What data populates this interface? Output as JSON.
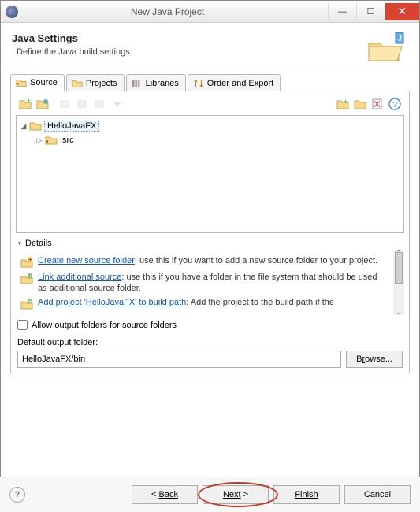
{
  "window": {
    "title": "New Java Project"
  },
  "header": {
    "title": "Java Settings",
    "subtitle": "Define the Java build settings."
  },
  "tabs": [
    {
      "label": "Source",
      "icon": "source-folder-icon",
      "active": true
    },
    {
      "label": "Projects",
      "icon": "projects-icon",
      "active": false
    },
    {
      "label": "Libraries",
      "icon": "libraries-icon",
      "active": false
    },
    {
      "label": "Order and Export",
      "icon": "order-export-icon",
      "active": false
    }
  ],
  "tree": {
    "root": {
      "label": "HelloJavaFX",
      "expanded": true,
      "selected": true
    },
    "children": [
      {
        "label": "src",
        "expanded": false
      }
    ]
  },
  "details": {
    "heading": "Details",
    "items": [
      {
        "link": "Create new source folder",
        "rest": ": use this if you want to add a new source folder to your project.",
        "icon": "new-source-folder-icon"
      },
      {
        "link": "Link additional source",
        "rest": ": use this if you have a folder in the file system that should be used as additional source folder.",
        "icon": "link-source-icon"
      },
      {
        "link": "Add project 'HelloJavaFX' to build path",
        "rest": ": Add the project to the build path if the",
        "icon": "add-buildpath-icon"
      }
    ]
  },
  "options": {
    "allowOutputFoldersLabel": "Allow output folders for source folders",
    "allowOutputFoldersChecked": false,
    "defaultOutputFolderLabel": "Default output folder:",
    "defaultOutputFolderValue": "HelloJavaFX/bin",
    "browseLabel": "Browse..."
  },
  "buttons": {
    "back": "Back",
    "next": "Next",
    "finish": "Finish",
    "cancel": "Cancel"
  }
}
